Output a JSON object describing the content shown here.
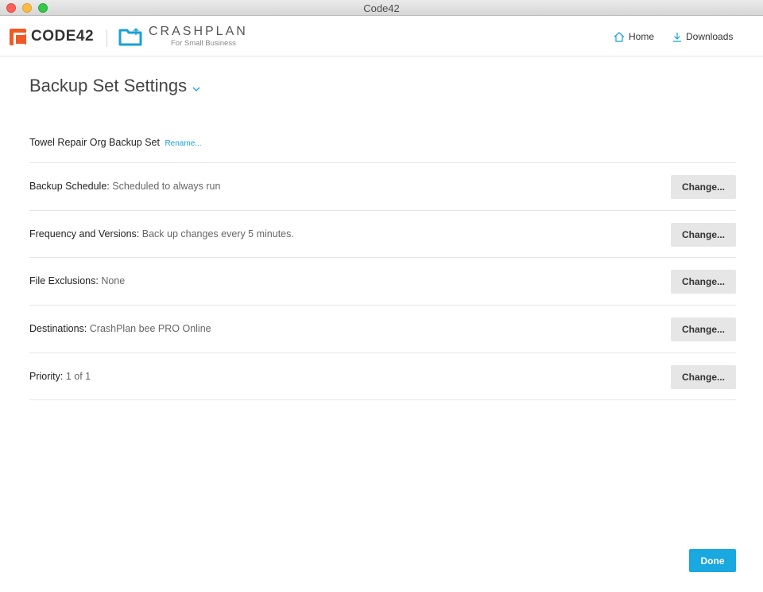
{
  "window": {
    "title": "Code42"
  },
  "header": {
    "code42_logo_text": "CODE42",
    "crashplan_brand": "CRASHPLAN",
    "crashplan_sub": "For Small Business",
    "nav": {
      "home": "Home",
      "downloads": "Downloads"
    }
  },
  "page": {
    "title": "Backup Set Settings",
    "backup_set_name": "Towel Repair Org Backup Set",
    "rename_label": "Rename..."
  },
  "settings": [
    {
      "label": "Backup Schedule:",
      "value": "Scheduled to always run",
      "button": "Change..."
    },
    {
      "label": "Frequency and Versions:",
      "value": "Back up changes every 5 minutes.",
      "button": "Change..."
    },
    {
      "label": "File Exclusions:",
      "value": "None",
      "button": "Change..."
    },
    {
      "label": "Destinations:",
      "value": "CrashPlan bee PRO Online",
      "button": "Change..."
    },
    {
      "label": "Priority:",
      "value": "1 of 1",
      "button": "Change..."
    }
  ],
  "footer": {
    "done_label": "Done"
  },
  "colors": {
    "accent": "#19a8e0",
    "brand_orange": "#f15a24"
  },
  "icons": [
    "home-icon",
    "download-icon",
    "chevron-down-icon",
    "crashplan-folder-icon"
  ]
}
